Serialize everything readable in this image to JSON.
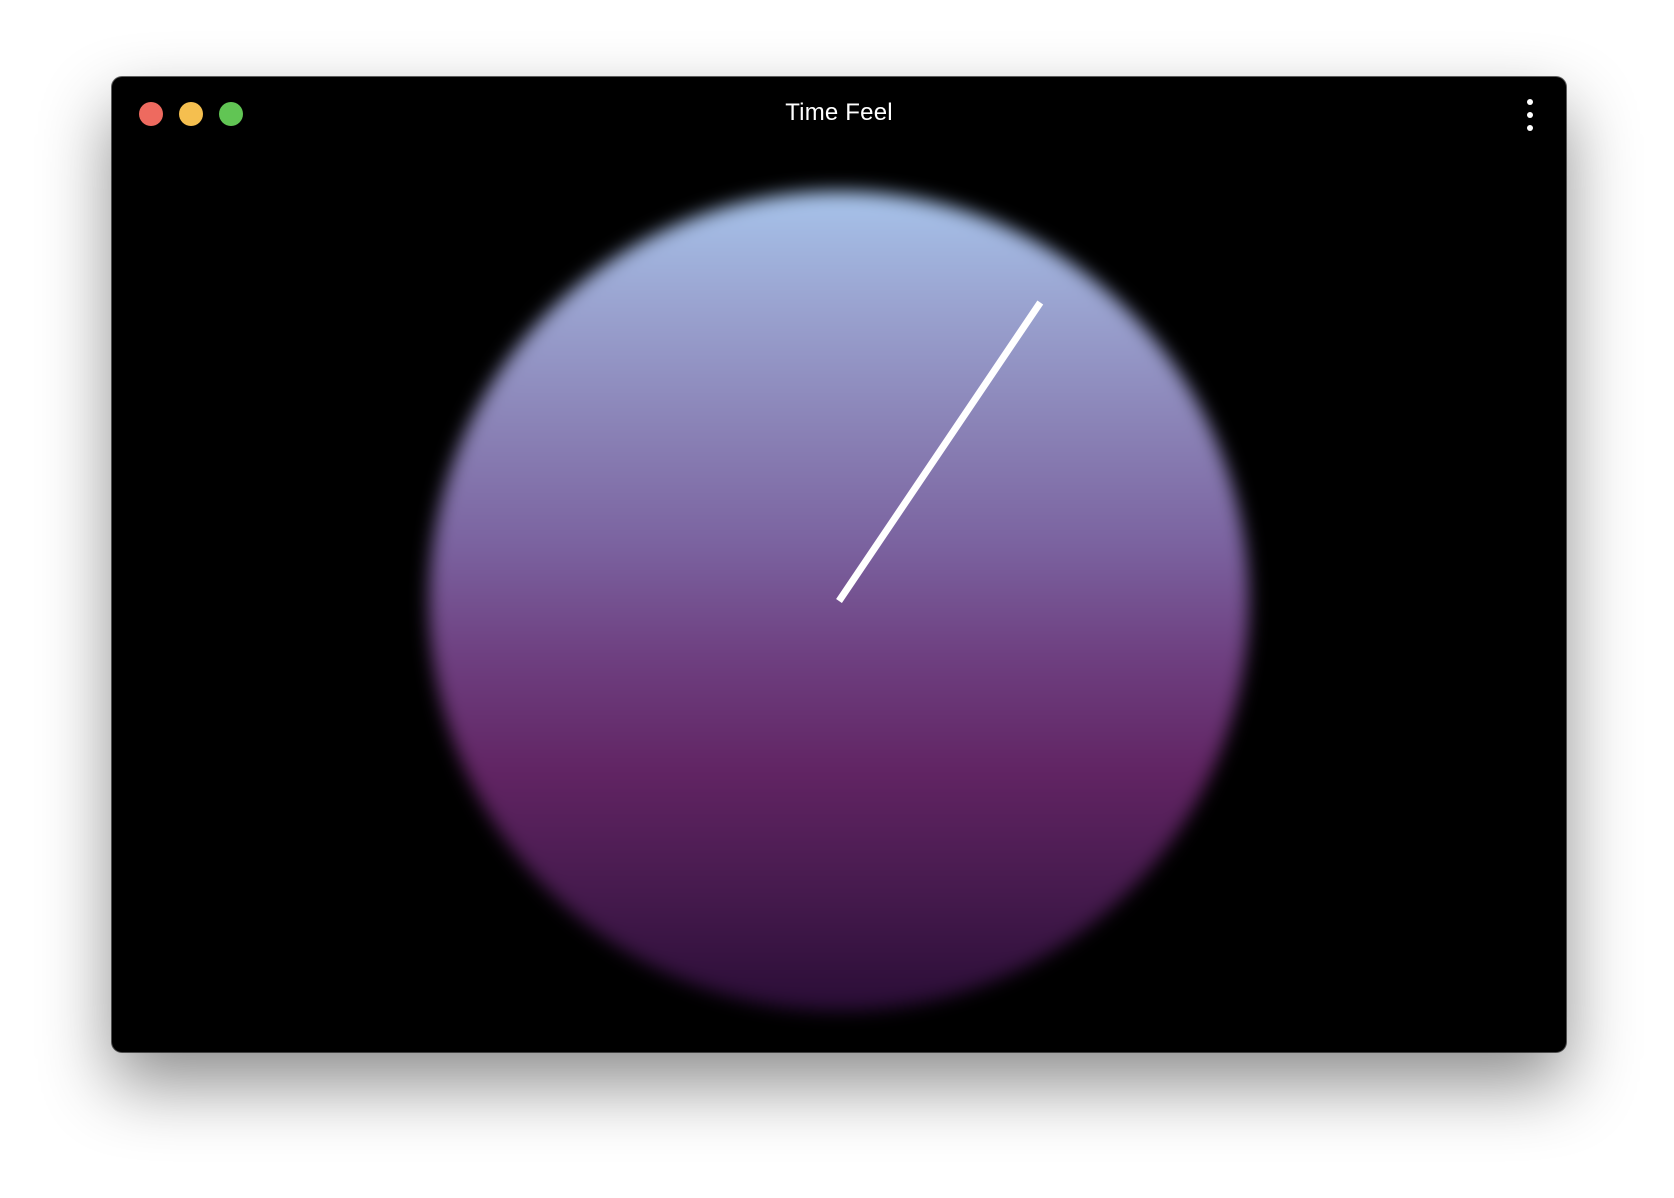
{
  "window": {
    "title": "Time Feel"
  },
  "icons": {
    "close": "close-icon",
    "minimize": "minimize-icon",
    "zoom": "zoom-icon",
    "menu": "vertical-ellipsis-icon"
  },
  "colors": {
    "background": "#000000",
    "traffic_close": "#ee6a5f",
    "traffic_minimize": "#f5bf4f",
    "traffic_zoom": "#61c554",
    "orb_gradient": [
      "#a7c4eb",
      "#9aa3d0",
      "#8a82b6",
      "#7b63a0",
      "#6e3f80",
      "#612463",
      "#451a4d",
      "#2a0d36"
    ],
    "hand": "#ffffff"
  },
  "clock": {
    "hand_angle_degrees": 34
  }
}
